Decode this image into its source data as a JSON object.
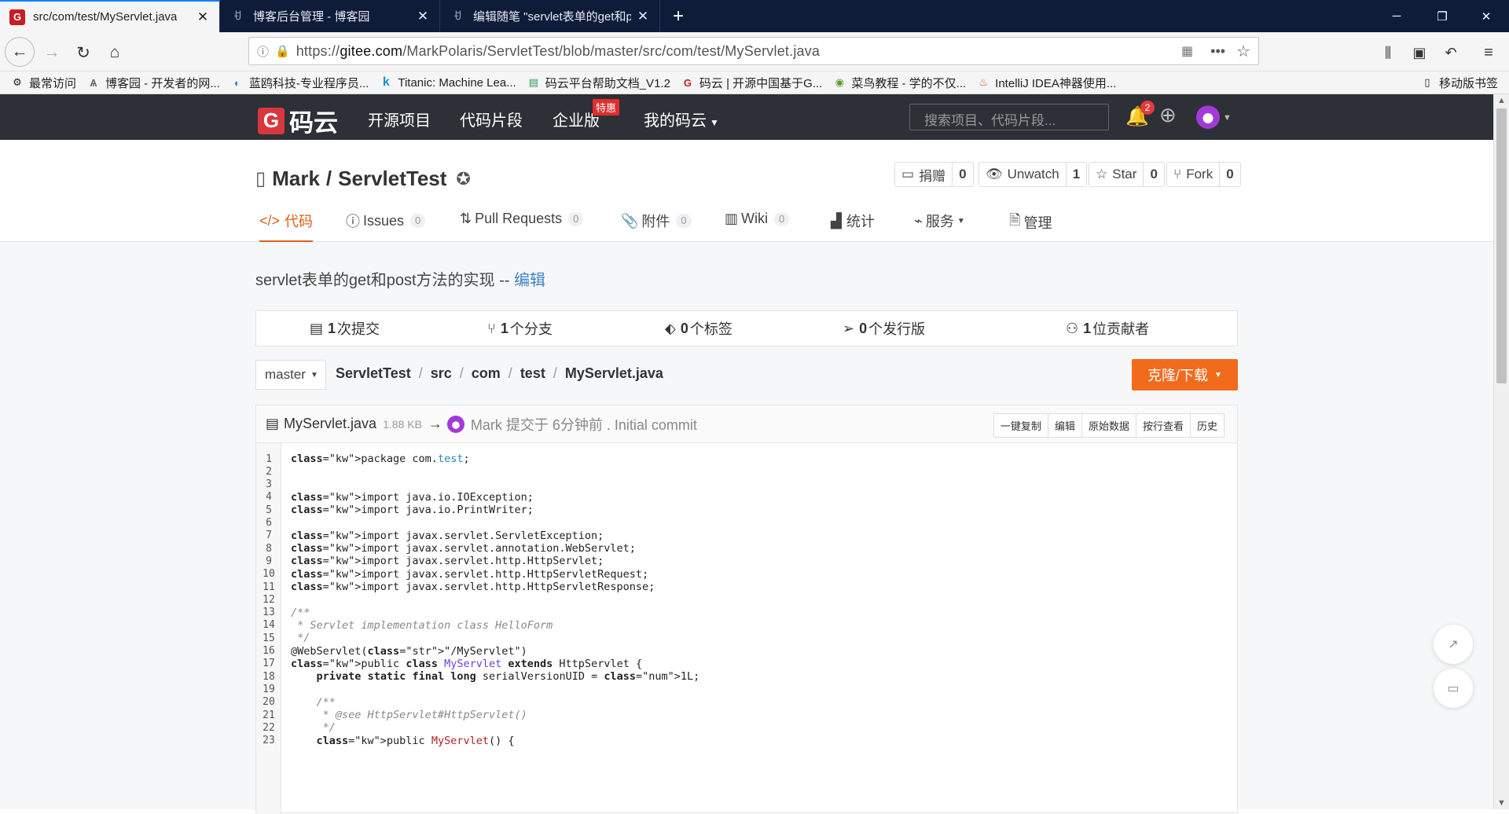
{
  "browser": {
    "tabs": [
      {
        "title": "src/com/test/MyServlet.java",
        "active": true
      },
      {
        "title": "博客后台管理 - 博客园",
        "active": false
      },
      {
        "title": "编辑随笔 \"servlet表单的get和po",
        "active": false
      }
    ],
    "url_prefix": "https://",
    "url_domain": "gitee.com",
    "url_path": "/MarkPolaris/ServletTest/blob/master/src/com/test/MyServlet.java",
    "bookmarks": [
      "最常访问",
      "博客园 - 开发者的网...",
      "蓝鸥科技-专业程序员...",
      "Titanic: Machine Lea...",
      "码云平台帮助文档_V1.2",
      "码云 | 开源中国基于G...",
      "菜鸟教程 - 学的不仅...",
      "IntelliJ IDEA神器使用..."
    ],
    "mobile_bookmarks": "移动版书签"
  },
  "site": {
    "logo_text": "码云",
    "nav": [
      "开源项目",
      "代码片段",
      "企业版",
      "我的码云"
    ],
    "special_badge": "特惠",
    "search_placeholder": "搜索项目、代码片段...",
    "notification_count": "2"
  },
  "repo": {
    "owner": "Mark",
    "separator": "/",
    "name": "ServletTest",
    "buttons": [
      {
        "label": "捐赠",
        "count": "0"
      },
      {
        "label": "Unwatch",
        "count": "1"
      },
      {
        "label": "Star",
        "count": "0"
      },
      {
        "label": "Fork",
        "count": "0"
      }
    ],
    "tabs": [
      {
        "label": "代码"
      },
      {
        "label": "Issues",
        "count": "0"
      },
      {
        "label": "Pull Requests",
        "count": "0"
      },
      {
        "label": "附件",
        "count": "0"
      },
      {
        "label": "Wiki",
        "count": "0"
      },
      {
        "label": "统计"
      },
      {
        "label": "服务"
      },
      {
        "label": "管理"
      }
    ],
    "description": "servlet表单的get和post方法的实现 -- ",
    "edit_link": "编辑",
    "stats": [
      {
        "num": "1",
        "label": "次提交"
      },
      {
        "num": "1",
        "label": "个分支"
      },
      {
        "num": "0",
        "label": "个标签"
      },
      {
        "num": "0",
        "label": "个发行版"
      },
      {
        "num": "1",
        "label": "位贡献者"
      }
    ],
    "branch": "master",
    "breadcrumb": [
      "ServletTest",
      "src",
      "com",
      "test",
      "MyServlet.java"
    ],
    "clone_label": "克隆/下载"
  },
  "file": {
    "name": "MyServlet.java",
    "size": "1.88 KB",
    "arrow": "→",
    "commit_meta": "Mark 提交于 6分钟前 . Initial commit",
    "actions": [
      "一键复制",
      "编辑",
      "原始数据",
      "按行查看",
      "历史"
    ],
    "lines": [
      "package com.test;",
      "",
      "",
      "import java.io.IOException;",
      "import java.io.PrintWriter;",
      "",
      "import javax.servlet.ServletException;",
      "import javax.servlet.annotation.WebServlet;",
      "import javax.servlet.http.HttpServlet;",
      "import javax.servlet.http.HttpServletRequest;",
      "import javax.servlet.http.HttpServletResponse;",
      "",
      "/**",
      " * Servlet implementation class HelloForm",
      " */",
      "@WebServlet(\"/MyServlet\")",
      "public class MyServlet extends HttpServlet {",
      "    private static final long serialVersionUID = 1L;",
      "",
      "    /**",
      "     * @see HttpServlet#HttpServlet()",
      "     */",
      "    public MyServlet() {"
    ]
  }
}
